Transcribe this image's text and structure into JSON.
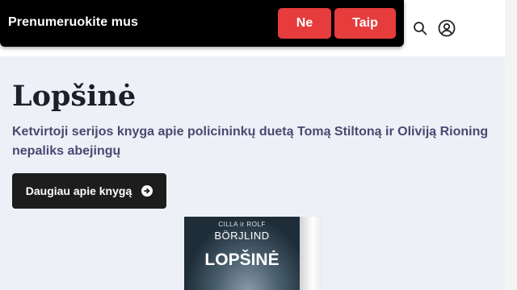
{
  "banner": {
    "text": "Prenumeruokite mus",
    "no_label": "Ne",
    "yes_label": "Taip"
  },
  "header": {
    "icons": [
      "search-icon",
      "user-icon"
    ]
  },
  "main": {
    "title": "Lopšinė",
    "subtitle": "Ketvirtoji serijos knyga apie policininkų duetą Tomą Stiltoną ir Oliviją Rioning nepaliks abejingų",
    "more_button_label": "Daugiau apie knygą",
    "more_button_icon": "arrow-circle-right-icon"
  },
  "book": {
    "author_top": "CILLA ir ROLF",
    "author": "BÖRJLIND",
    "title": "LOPŠINĖ"
  },
  "colors": {
    "banner_bg": "#000000",
    "banner_button": "#e63c3c",
    "page_bg": "#eef0f8",
    "subtitle": "#4a4870",
    "primary_button": "#1d1d1d"
  }
}
